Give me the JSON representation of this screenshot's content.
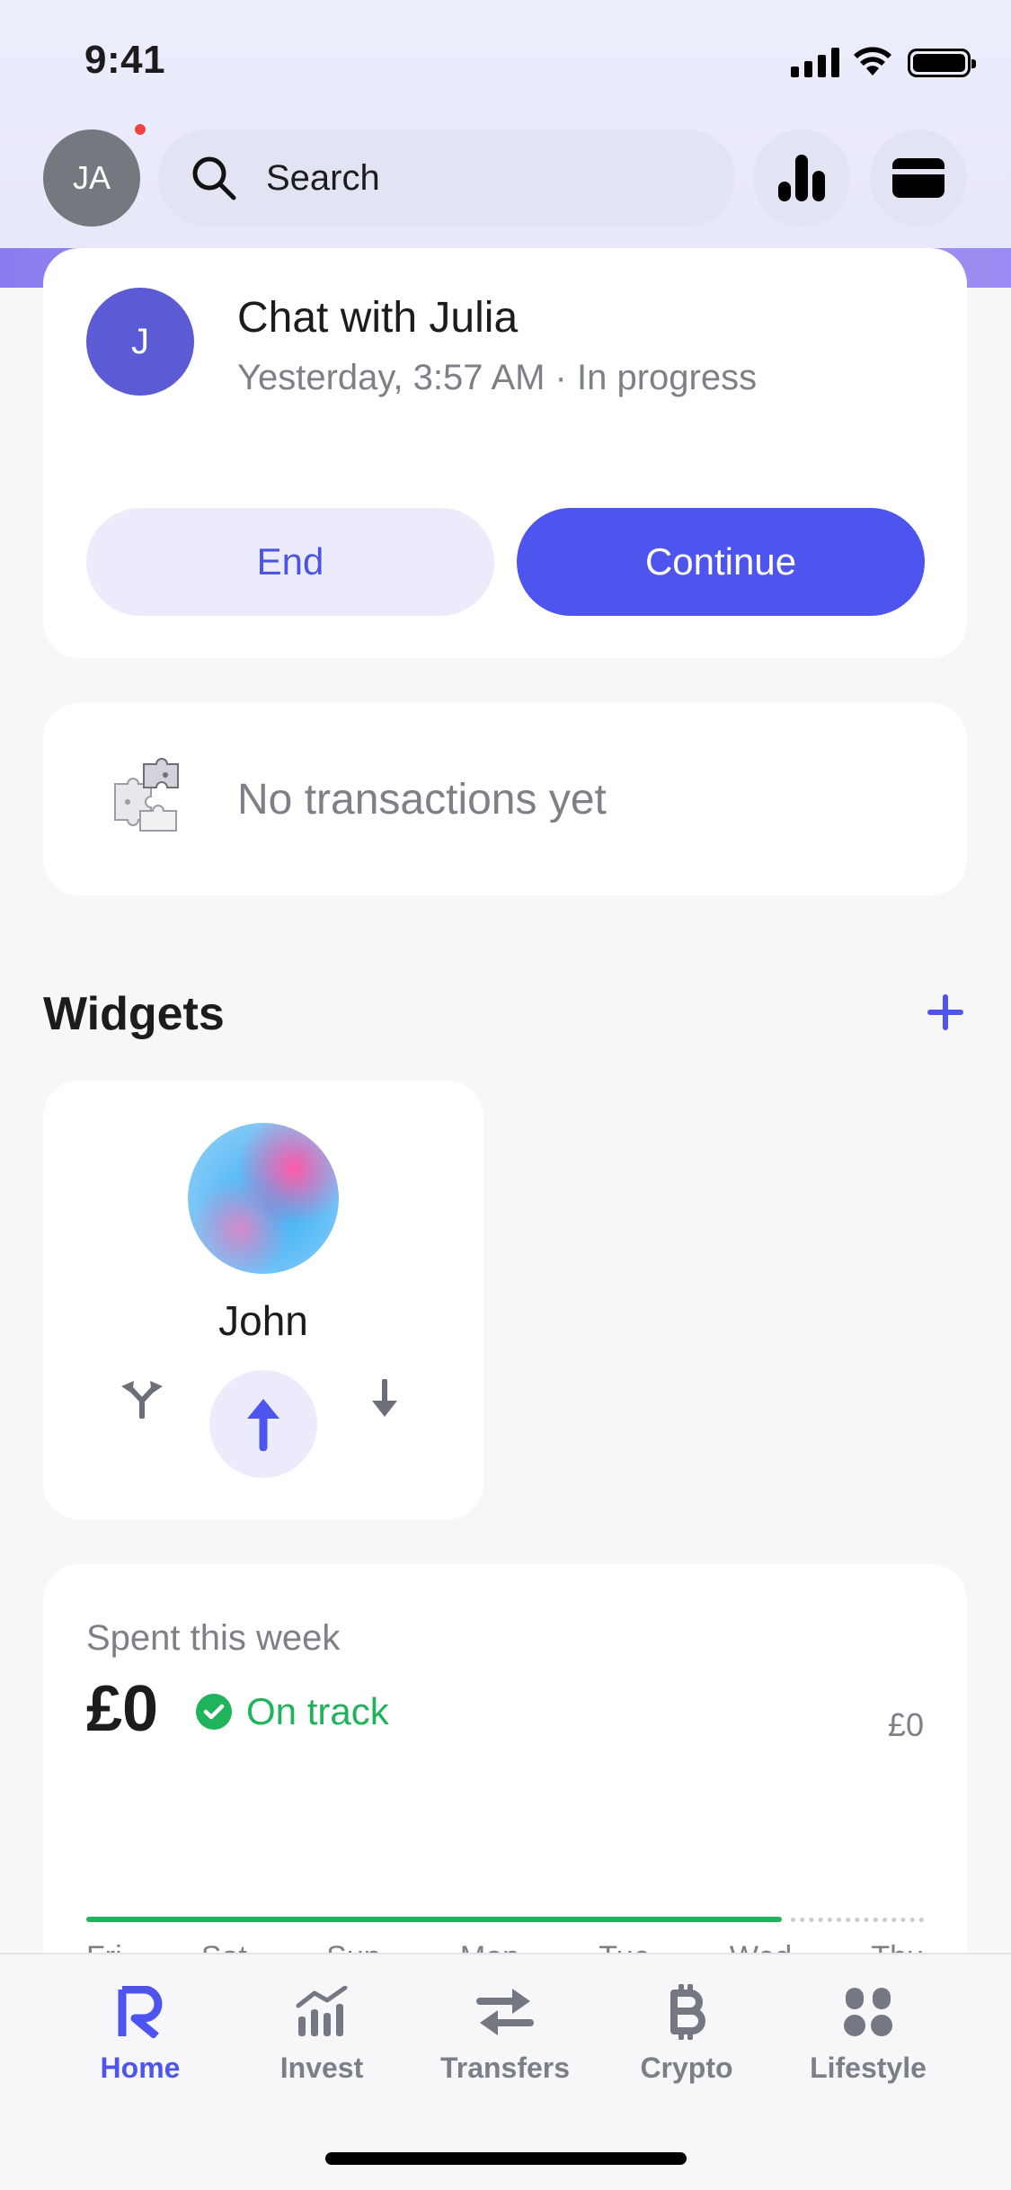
{
  "status_bar": {
    "time": "9:41"
  },
  "header": {
    "avatar_initials": "JA",
    "search_placeholder": "Search",
    "stats_icon": "bar-chart-icon",
    "card_icon": "card-icon"
  },
  "chat_card": {
    "avatar_letter": "J",
    "title": "Chat with Julia",
    "subtitle": "Yesterday, 3:57 AM · In progress",
    "end_label": "End",
    "continue_label": "Continue"
  },
  "transactions": {
    "empty_text": "No transactions yet",
    "icon": "puzzle-icon"
  },
  "widgets": {
    "title": "Widgets",
    "add_icon": "plus-icon",
    "contact": {
      "name": "John",
      "actions": [
        "split-icon",
        "send-icon",
        "request-icon"
      ]
    }
  },
  "spending": {
    "label": "Spent this week",
    "amount": "£0",
    "status": "On track",
    "limit": "£0",
    "progress": 0.84,
    "days": [
      "Fri",
      "Sat",
      "Sun",
      "Mon",
      "Tue",
      "Wed",
      "Thu"
    ]
  },
  "tabbar": {
    "items": [
      {
        "label": "Home",
        "icon": "home-logo-icon",
        "active": true
      },
      {
        "label": "Invest",
        "icon": "invest-icon",
        "active": false
      },
      {
        "label": "Transfers",
        "icon": "transfers-icon",
        "active": false
      },
      {
        "label": "Crypto",
        "icon": "bitcoin-icon",
        "active": false
      },
      {
        "label": "Lifestyle",
        "icon": "lifestyle-icon",
        "active": false
      }
    ]
  },
  "colors": {
    "accent": "#4d55ee",
    "success": "#1fb45b",
    "muted": "#7d8087"
  }
}
